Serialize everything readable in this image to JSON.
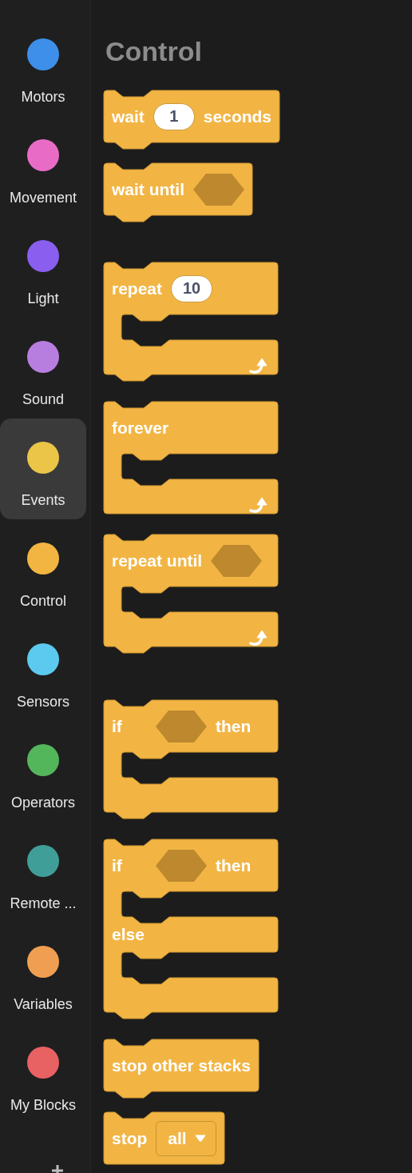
{
  "categories": [
    {
      "label": "Motors",
      "color": "#3d8fea",
      "selected": false
    },
    {
      "label": "Movement",
      "color": "#e86cc6",
      "selected": false
    },
    {
      "label": "Light",
      "color": "#8a5ff0",
      "selected": false
    },
    {
      "label": "Sound",
      "color": "#b77ddf",
      "selected": false
    },
    {
      "label": "Events",
      "color": "#ebc548",
      "selected": true
    },
    {
      "label": "Control",
      "color": "#f3b541",
      "selected": false
    },
    {
      "label": "Sensors",
      "color": "#5bcaee",
      "selected": false
    },
    {
      "label": "Operators",
      "color": "#54b65b",
      "selected": false
    },
    {
      "label": "Remote ...",
      "color": "#3f9e98",
      "selected": false
    },
    {
      "label": "Variables",
      "color": "#f09f52",
      "selected": false
    },
    {
      "label": "My Blocks",
      "color": "#e86163",
      "selected": false
    }
  ],
  "palette": {
    "title": "Control",
    "groups": [
      [
        {
          "kind": "stack",
          "bottom_notch": true,
          "arms": [
            [
              {
                "kind": "text",
                "text": "wait"
              },
              {
                "kind": "number",
                "value": "1"
              },
              {
                "kind": "text",
                "text": "seconds"
              }
            ]
          ]
        },
        {
          "kind": "stack",
          "bottom_notch": true,
          "arms": [
            [
              {
                "kind": "text",
                "text": "wait until"
              },
              {
                "kind": "boolean"
              }
            ]
          ]
        }
      ],
      [
        {
          "kind": "c",
          "bottom_notch": true,
          "loop_arrow": true,
          "arms": [
            [
              {
                "kind": "text",
                "text": "repeat"
              },
              {
                "kind": "number",
                "value": "10"
              }
            ]
          ]
        },
        {
          "kind": "c",
          "bottom_notch": false,
          "loop_arrow": true,
          "arms": [
            [
              {
                "kind": "text",
                "text": "forever"
              }
            ]
          ]
        },
        {
          "kind": "c",
          "bottom_notch": true,
          "loop_arrow": true,
          "arms": [
            [
              {
                "kind": "text",
                "text": "repeat until"
              },
              {
                "kind": "boolean"
              }
            ]
          ]
        }
      ],
      [
        {
          "kind": "c",
          "bottom_notch": true,
          "loop_arrow": false,
          "arms": [
            [
              {
                "kind": "text",
                "text": "if"
              },
              {
                "kind": "boolean"
              },
              {
                "kind": "text",
                "text": "then"
              }
            ]
          ]
        },
        {
          "kind": "c",
          "bottom_notch": true,
          "loop_arrow": false,
          "arms": [
            [
              {
                "kind": "text",
                "text": "if"
              },
              {
                "kind": "boolean"
              },
              {
                "kind": "text",
                "text": "then"
              }
            ],
            [
              {
                "kind": "text",
                "text": "else"
              }
            ]
          ]
        },
        {
          "kind": "stack",
          "bottom_notch": true,
          "arms": [
            [
              {
                "kind": "text",
                "text": "stop other stacks"
              }
            ]
          ]
        },
        {
          "kind": "stack",
          "bottom_notch": false,
          "arms": [
            [
              {
                "kind": "text",
                "text": "stop"
              },
              {
                "kind": "dropdown",
                "value": "all"
              }
            ]
          ]
        }
      ]
    ]
  }
}
